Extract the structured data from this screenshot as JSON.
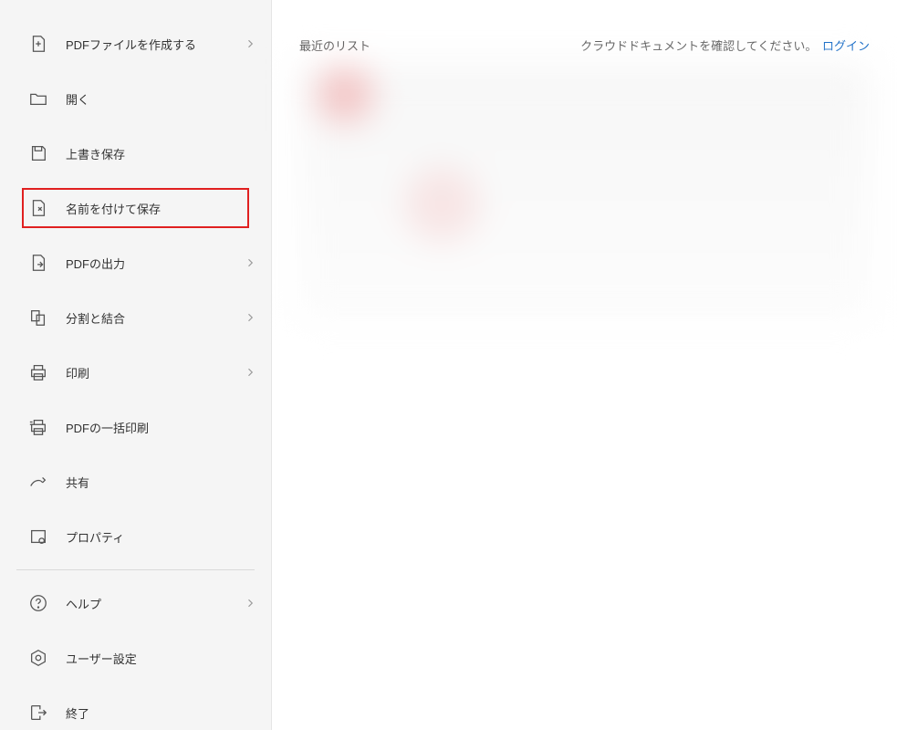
{
  "sidebar": {
    "items": [
      {
        "label": "PDFファイルを作成する",
        "chevron": true
      },
      {
        "label": "開く",
        "chevron": false
      },
      {
        "label": "上書き保存",
        "chevron": false
      },
      {
        "label": "名前を付けて保存",
        "chevron": false,
        "highlight": true
      },
      {
        "label": "PDFの出力",
        "chevron": true
      },
      {
        "label": "分割と結合",
        "chevron": true
      },
      {
        "label": "印刷",
        "chevron": true
      },
      {
        "label": "PDFの一括印刷",
        "chevron": false
      },
      {
        "label": "共有",
        "chevron": false
      },
      {
        "label": "プロパティ",
        "chevron": false
      }
    ],
    "footer": [
      {
        "label": "ヘルプ",
        "chevron": true
      },
      {
        "label": "ユーザー設定",
        "chevron": false
      },
      {
        "label": "終了",
        "chevron": false
      }
    ]
  },
  "main": {
    "recent_label": "最近のリスト",
    "cloud_message": "クラウドドキュメントを確認してください。",
    "login": "ログイン"
  }
}
